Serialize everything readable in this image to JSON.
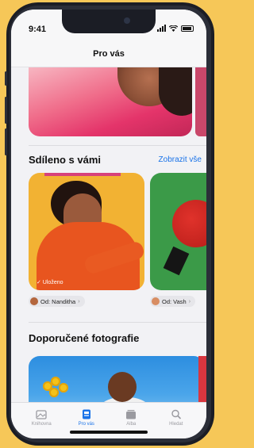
{
  "status": {
    "time": "9:41"
  },
  "header": {
    "title": "Pro vás"
  },
  "shared": {
    "section_title": "Sdíleno s vámi",
    "see_all": "Zobrazit vše",
    "card1_badge": "✓ Uloženo",
    "chips": [
      {
        "label": "Od: Nanditha",
        "avatar_color": "#b4663d"
      },
      {
        "label": "Od: Vash",
        "avatar_color": "#d88d62"
      }
    ]
  },
  "recommended": {
    "section_title": "Doporučené fotografie"
  },
  "tabs": [
    {
      "label": "Knihovna",
      "icon": "photo-library-icon",
      "active": false
    },
    {
      "label": "Pro vás",
      "icon": "for-you-icon",
      "active": true
    },
    {
      "label": "Alba",
      "icon": "albums-icon",
      "active": false
    },
    {
      "label": "Hledat",
      "icon": "search-icon",
      "active": false
    }
  ],
  "colors": {
    "accent": "#1a73e8",
    "background": "#f6c758"
  }
}
